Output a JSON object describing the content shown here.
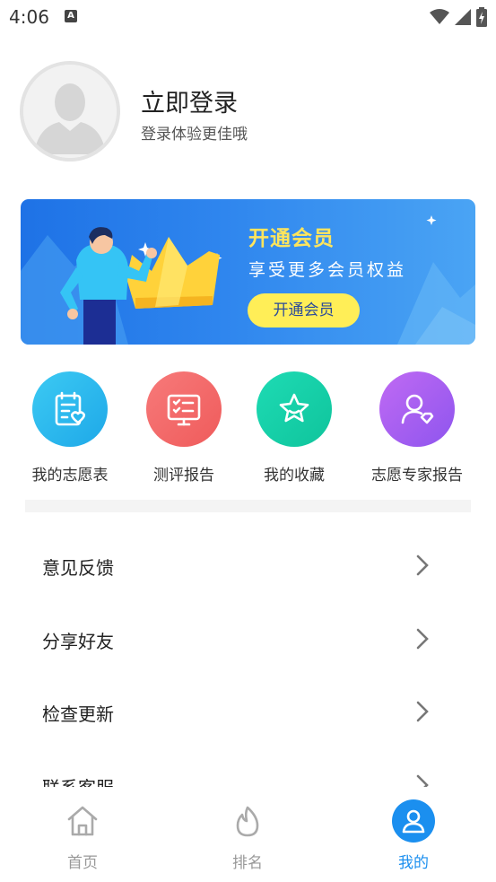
{
  "status_bar": {
    "time": "4:06",
    "notification_badge": "A",
    "icons": [
      "wifi-icon",
      "signal-icon",
      "battery-charging-icon"
    ]
  },
  "profile": {
    "title": "立即登录",
    "subtitle": "登录体验更佳哦"
  },
  "banner": {
    "title": "开通会员",
    "subtitle": "享受更多会员权益",
    "button_label": "开通会员",
    "colors": {
      "title": "#ffe55c",
      "button_bg": "#ffee57",
      "bg_start": "#1e72e6",
      "bg_end": "#4aa4f4"
    }
  },
  "shortcuts": [
    {
      "label": "我的志愿表",
      "icon": "application-form-icon",
      "color": "#29b8ee"
    },
    {
      "label": "测评报告",
      "icon": "assessment-report-icon",
      "color": "#f26a6a"
    },
    {
      "label": "我的收藏",
      "icon": "star-icon",
      "color": "#14d1a8"
    },
    {
      "label": "志愿专家报告",
      "icon": "expert-icon",
      "color": "#a85ff0"
    }
  ],
  "menu": [
    {
      "label": "意见反馈"
    },
    {
      "label": "分享好友"
    },
    {
      "label": "检查更新"
    },
    {
      "label": "联系客服"
    }
  ],
  "bottom_nav": [
    {
      "label": "首页",
      "icon": "home-icon",
      "active": false
    },
    {
      "label": "排名",
      "icon": "flame-icon",
      "active": false
    },
    {
      "label": "我的",
      "icon": "user-icon",
      "active": true
    }
  ],
  "accent_color": "#1b8fef"
}
